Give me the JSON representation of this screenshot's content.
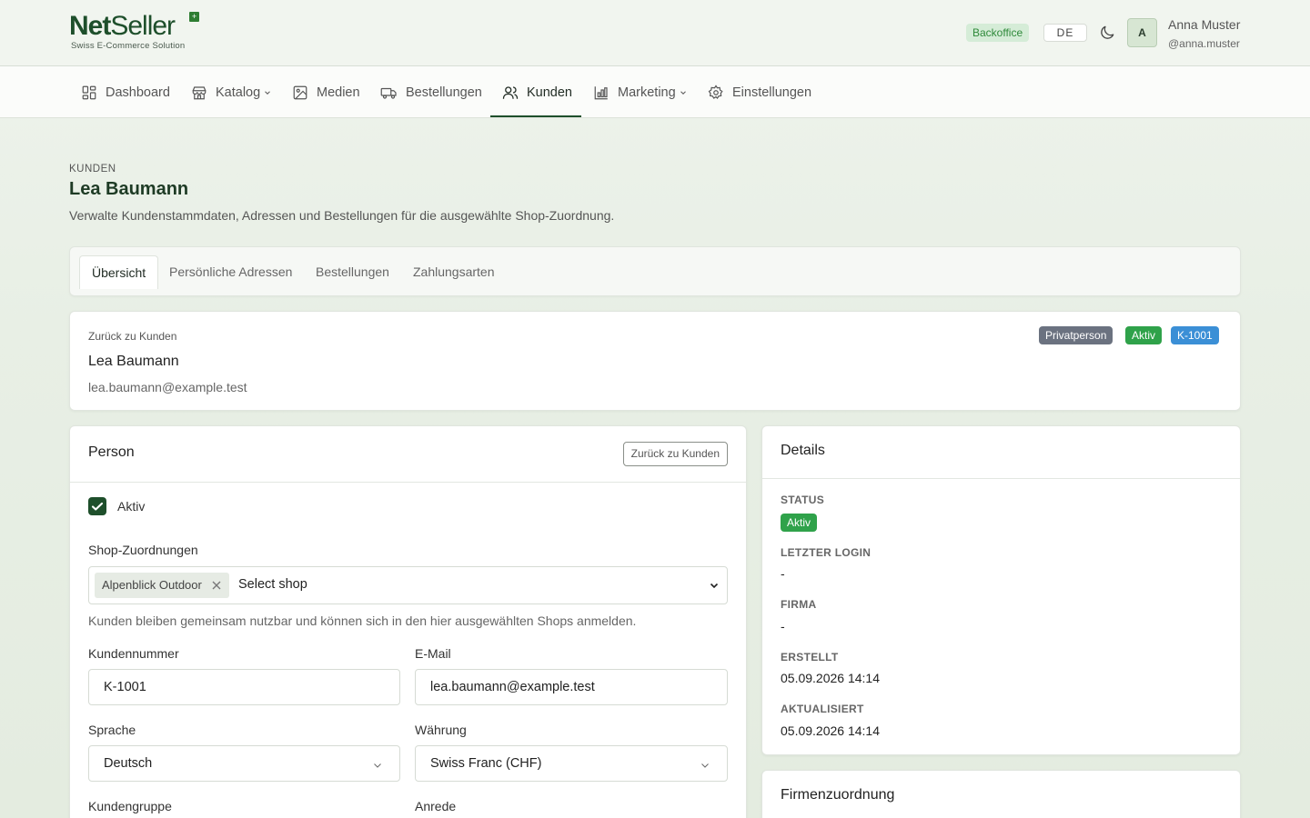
{
  "header": {
    "logo_main_bold": "Net",
    "logo_main_rest": "Seller",
    "logo_tagline": "Swiss E-Commerce Solution",
    "badge": "Backoffice",
    "language": "DE",
    "avatar_initial": "A",
    "user_name": "Anna Muster",
    "user_handle": "@anna.muster"
  },
  "nav": {
    "items": [
      {
        "label": "Dashboard",
        "icon": "dashboard-icon"
      },
      {
        "label": "Katalog",
        "icon": "store-icon",
        "dropdown": true
      },
      {
        "label": "Medien",
        "icon": "image-icon"
      },
      {
        "label": "Bestellungen",
        "icon": "truck-icon"
      },
      {
        "label": "Kunden",
        "icon": "users-icon",
        "active": true
      },
      {
        "label": "Marketing",
        "icon": "chart-icon",
        "dropdown": true
      },
      {
        "label": "Einstellungen",
        "icon": "gear-icon"
      }
    ]
  },
  "page": {
    "eyebrow": "KUNDEN",
    "title": "Lea Baumann",
    "description": "Verwalte Kundenstammdaten, Adressen und Bestellungen für die ausgewählte Shop-Zuordnung."
  },
  "tabs": [
    "Übersicht",
    "Persönliche Adressen",
    "Bestellungen",
    "Zahlungsarten"
  ],
  "summary": {
    "back_link": "Zurück zu Kunden",
    "name": "Lea Baumann",
    "email": "lea.baumann@example.test",
    "badges": [
      {
        "label": "Privatperson",
        "color": "#6b7280"
      },
      {
        "label": "Aktiv",
        "color": "#2fa24a"
      },
      {
        "label": "K-1001",
        "color": "#3b8fd6"
      }
    ]
  },
  "person": {
    "title": "Person",
    "back_button": "Zurück zu Kunden",
    "active_label": "Aktiv",
    "active_checked": true,
    "shop_label": "Shop-Zuordnungen",
    "shop_chip": "Alpenblick Outdoor",
    "shop_placeholder": "Select shop",
    "shop_help": "Kunden bleiben gemeinsam nutzbar und können sich in den hier ausgewählten Shops anmelden.",
    "customer_number_label": "Kundennummer",
    "customer_number": "K-1001",
    "email_label": "E-Mail",
    "email": "lea.baumann@example.test",
    "language_label": "Sprache",
    "language": "Deutsch",
    "currency_label": "Währung",
    "currency": "Swiss Franc (CHF)",
    "group_label": "Kundengruppe",
    "salutation_label": "Anrede"
  },
  "details": {
    "title": "Details",
    "status_label": "STATUS",
    "status": "Aktiv",
    "last_login_label": "LETZTER LOGIN",
    "last_login": "-",
    "company_label": "FIRMA",
    "company": "-",
    "created_label": "ERSTELLT",
    "created": "05.09.2026 14:14",
    "updated_label": "AKTUALISIERT",
    "updated": "05.09.2026 14:14"
  },
  "firm": {
    "title": "Firmenzuordnung"
  },
  "colors": {
    "brand": "#1e4f2b",
    "success": "#2fa24a",
    "info": "#3b8fd6",
    "neutral_badge": "#6b7280"
  }
}
